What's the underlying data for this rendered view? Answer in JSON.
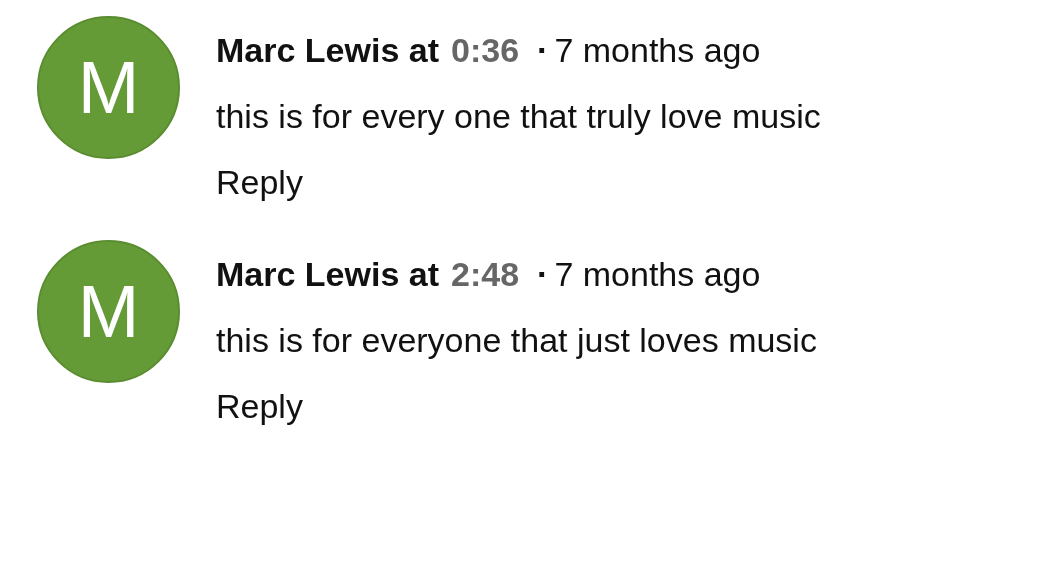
{
  "comments": [
    {
      "avatar": "M",
      "author": "Marc Lewis",
      "at": "at",
      "timestamp": "0:36",
      "separator": "·",
      "age": "7 months ago",
      "text": "this is for every one that truly love music",
      "reply": "Reply"
    },
    {
      "avatar": "M",
      "author": "Marc Lewis",
      "at": "at",
      "timestamp": "2:48",
      "separator": "·",
      "age": "7 months ago",
      "text": "this is for everyone that just loves music",
      "reply": "Reply"
    }
  ]
}
